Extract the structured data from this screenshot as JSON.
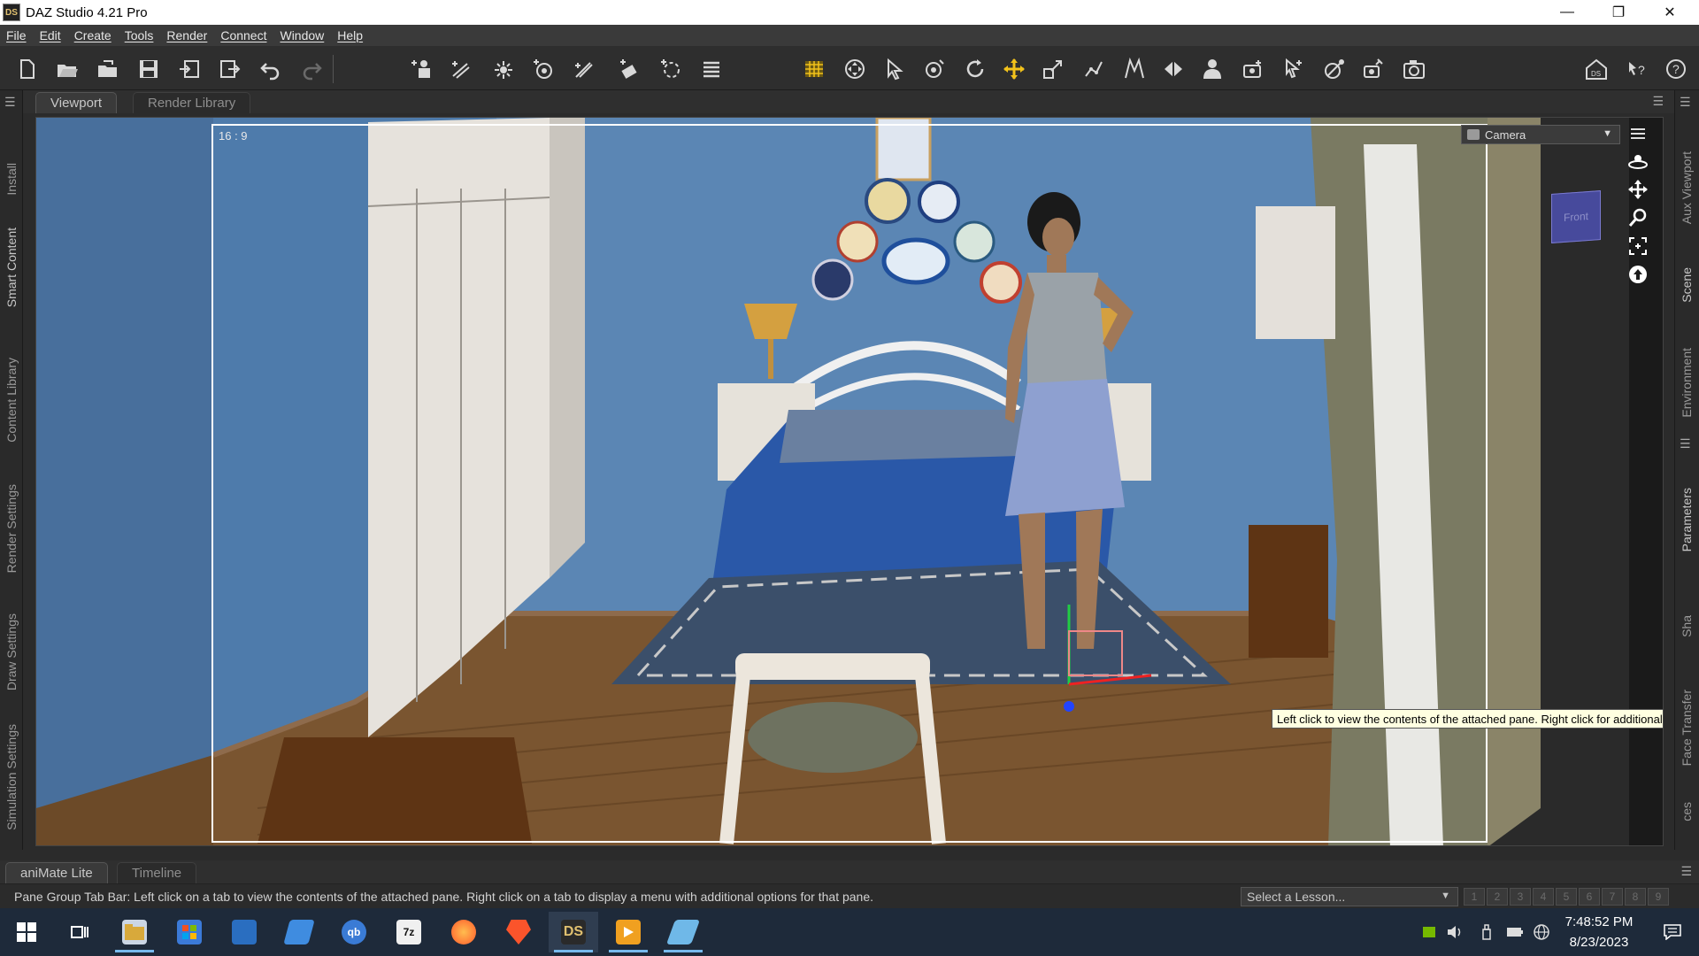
{
  "window": {
    "app_icon_text": "DS",
    "title": "DAZ Studio 4.21 Pro"
  },
  "menu": [
    "File",
    "Edit",
    "Create",
    "Tools",
    "Render",
    "Connect",
    "Window",
    "Help"
  ],
  "toolbar": {
    "file_tools": [
      "new-file-icon",
      "open-folder-icon",
      "open-recent-icon",
      "save-icon",
      "import-icon",
      "export-icon",
      "undo-icon",
      "redo-icon"
    ],
    "create_tools": [
      "new-figure-icon",
      "spotlight-icon",
      "distant-light-icon",
      "point-light-icon",
      "linear-light-icon",
      "camera-create-icon",
      "null-icon",
      "list-icon"
    ],
    "scene_tools": [
      "render-grid-icon",
      "universal-tool-icon",
      "node-selection-icon",
      "rotate-joint-icon",
      "rotate-icon",
      "translate-icon",
      "scale-icon",
      "joint-editor-icon",
      "polygon-editor-icon",
      "surface-selection-icon",
      "figure-setup-icon",
      "camera-tool-icon",
      "active-pose-icon",
      "spot-render-icon",
      "iray-section-icon",
      "render-icon"
    ],
    "right_tools": [
      "daz-home-icon",
      "whats-this-icon",
      "help-icon"
    ]
  },
  "left_tabs": [
    "Install",
    "Smart Content",
    "Content Library",
    "Render Settings",
    "Draw Settings",
    "Simulation Settings"
  ],
  "right_tabs": [
    "Aux Viewport",
    "Scene",
    "Environment",
    "Parameters",
    "Sha",
    "Face Transfer",
    "ces"
  ],
  "tabs": {
    "viewport": "Viewport",
    "render_library": "Render Library"
  },
  "viewport": {
    "aspect_label": "16 : 9",
    "camera_select": "Camera",
    "view_cube_label": "Front",
    "tooltip": "Left click to view the contents of the attached pane. Right click for additional options."
  },
  "bottom_tabs": {
    "animate": "aniMate Lite",
    "timeline": "Timeline"
  },
  "status_text": "Pane Group Tab Bar: Left click on a tab to view the contents of the attached pane. Right click on a tab to display a menu with additional options for that pane.",
  "lesson_select": "Select a Lesson...",
  "lesson_steps": [
    "1",
    "2",
    "3",
    "4",
    "5",
    "6",
    "7",
    "8",
    "9"
  ],
  "taskbar": {
    "apps": [
      "windows-start-icon",
      "task-view-icon",
      "file-explorer-icon",
      "microsoft-store-icon",
      "remote-desktop-icon",
      "notes-icon",
      "qbittorrent-icon",
      "7zip-icon",
      "firefox-icon",
      "brave-icon",
      "daz-studio-icon",
      "media-player-icon",
      "app-icon"
    ],
    "qb_label": "qb",
    "zip_label": "7z",
    "ds_label": "DS",
    "time": "7:48:52 PM",
    "date": "8/23/2023"
  },
  "colors": {
    "accent_yellow": "#f2c21b",
    "wall_blue": "#5b86b4",
    "floor_brown": "#7a5530",
    "tooltip_bg": "#ffffe1"
  }
}
